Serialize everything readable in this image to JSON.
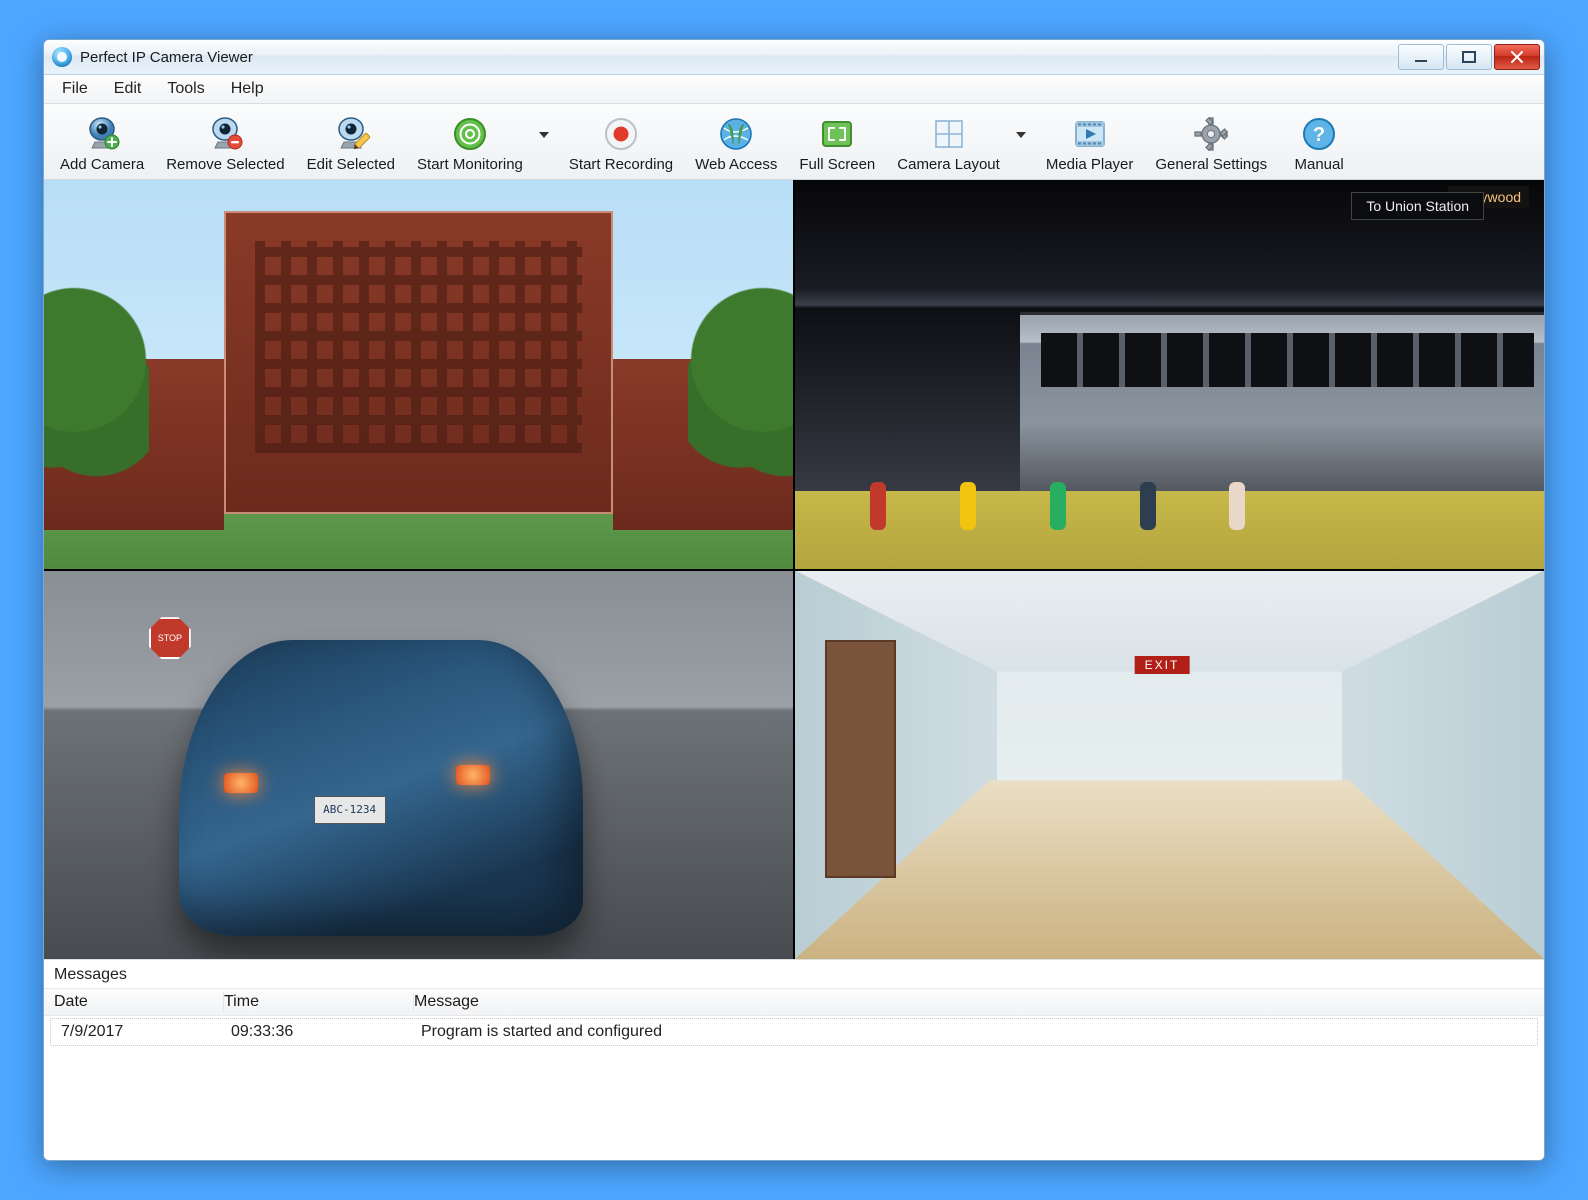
{
  "app": {
    "title": "Perfect IP Camera Viewer"
  },
  "menu": {
    "file": "File",
    "edit": "Edit",
    "tools": "Tools",
    "help": "Help"
  },
  "toolbar": {
    "add_camera": "Add Camera",
    "remove_selected": "Remove Selected",
    "edit_selected": "Edit Selected",
    "start_monitoring": "Start Monitoring",
    "start_recording": "Start Recording",
    "web_access": "Web Access",
    "full_screen": "Full Screen",
    "camera_layout": "Camera Layout",
    "media_player": "Media Player",
    "general_settings": "General Settings",
    "manual": "Manual"
  },
  "feeds": {
    "cam2_sign": "To Union Station",
    "cam2_sign2": "Hollywood",
    "cam3_plate": "ABC-1234",
    "cam3_stop": "STOP",
    "cam4_exit": "EXIT"
  },
  "messages": {
    "panel_label": "Messages",
    "headers": {
      "date": "Date",
      "time": "Time",
      "message": "Message"
    },
    "rows": [
      {
        "date": "7/9/2017",
        "time": "09:33:36",
        "message": "Program is started and configured"
      }
    ]
  }
}
